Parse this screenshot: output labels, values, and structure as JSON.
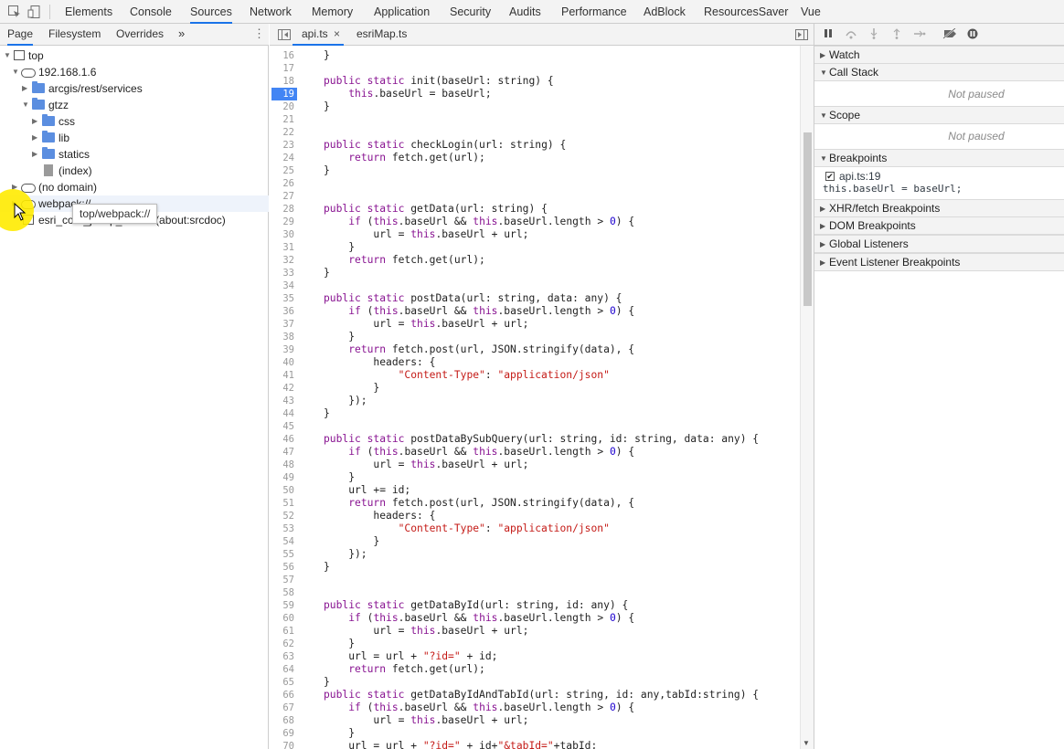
{
  "top_tabs": [
    "Elements",
    "Console",
    "Sources",
    "Network",
    "Memory",
    "Application",
    "Security",
    "Audits",
    "Performance",
    "AdBlock",
    "ResourcesSaver",
    "Vue"
  ],
  "active_top_tab": "Sources",
  "navigator": {
    "tabs": [
      "Page",
      "Filesystem",
      "Overrides"
    ],
    "more": "»",
    "tree": [
      "top",
      "192.168.1.6",
      "arcgis/rest/services",
      "gtzz",
      "css",
      "lib",
      "statics",
      "(index)",
      "(no domain)",
      "webpack://",
      "esri_core_jsonp_iframe (about:srcdoc)"
    ],
    "tooltip": "top/webpack://"
  },
  "editor": {
    "tabs": [
      "api.ts",
      "esriMap.ts"
    ],
    "close": "×",
    "lines": [
      {
        "n": "16",
        "t": "    }"
      },
      {
        "n": "17",
        "t": ""
      },
      {
        "n": "18",
        "t": "    public static init(baseUrl: string) {"
      },
      {
        "n": "19",
        "t": "        this.baseUrl = baseUrl;"
      },
      {
        "n": "20",
        "t": "    }"
      },
      {
        "n": "21",
        "t": ""
      },
      {
        "n": "22",
        "t": ""
      },
      {
        "n": "23",
        "t": "    public static checkLogin(url: string) {"
      },
      {
        "n": "24",
        "t": "        return fetch.get(url);"
      },
      {
        "n": "25",
        "t": "    }"
      },
      {
        "n": "26",
        "t": ""
      },
      {
        "n": "27",
        "t": ""
      },
      {
        "n": "28",
        "t": "    public static getData(url: string) {"
      },
      {
        "n": "29",
        "t": "        if (this.baseUrl && this.baseUrl.length > 0) {"
      },
      {
        "n": "30",
        "t": "            url = this.baseUrl + url;"
      },
      {
        "n": "31",
        "t": "        }"
      },
      {
        "n": "32",
        "t": "        return fetch.get(url);"
      },
      {
        "n": "33",
        "t": "    }"
      },
      {
        "n": "34",
        "t": ""
      },
      {
        "n": "35",
        "t": "    public static postData(url: string, data: any) {"
      },
      {
        "n": "36",
        "t": "        if (this.baseUrl && this.baseUrl.length > 0) {"
      },
      {
        "n": "37",
        "t": "            url = this.baseUrl + url;"
      },
      {
        "n": "38",
        "t": "        }"
      },
      {
        "n": "39",
        "t": "        return fetch.post(url, JSON.stringify(data), {"
      },
      {
        "n": "40",
        "t": "            headers: {"
      },
      {
        "n": "41",
        "t": "                \"Content-Type\": \"application/json\""
      },
      {
        "n": "42",
        "t": "            }"
      },
      {
        "n": "43",
        "t": "        });"
      },
      {
        "n": "44",
        "t": "    }"
      },
      {
        "n": "45",
        "t": ""
      },
      {
        "n": "46",
        "t": "    public static postDataBySubQuery(url: string, id: string, data: any) {"
      },
      {
        "n": "47",
        "t": "        if (this.baseUrl && this.baseUrl.length > 0) {"
      },
      {
        "n": "48",
        "t": "            url = this.baseUrl + url;"
      },
      {
        "n": "49",
        "t": "        }"
      },
      {
        "n": "50",
        "t": "        url += id;"
      },
      {
        "n": "51",
        "t": "        return fetch.post(url, JSON.stringify(data), {"
      },
      {
        "n": "52",
        "t": "            headers: {"
      },
      {
        "n": "53",
        "t": "                \"Content-Type\": \"application/json\""
      },
      {
        "n": "54",
        "t": "            }"
      },
      {
        "n": "55",
        "t": "        });"
      },
      {
        "n": "56",
        "t": "    }"
      },
      {
        "n": "57",
        "t": ""
      },
      {
        "n": "58",
        "t": ""
      },
      {
        "n": "59",
        "t": "    public static getDataById(url: string, id: any) {"
      },
      {
        "n": "60",
        "t": "        if (this.baseUrl && this.baseUrl.length > 0) {"
      },
      {
        "n": "61",
        "t": "            url = this.baseUrl + url;"
      },
      {
        "n": "62",
        "t": "        }"
      },
      {
        "n": "63",
        "t": "        url = url + \"?id=\" + id;"
      },
      {
        "n": "64",
        "t": "        return fetch.get(url);"
      },
      {
        "n": "65",
        "t": "    }"
      },
      {
        "n": "66",
        "t": "    public static getDataByIdAndTabId(url: string, id: any,tabId:string) {"
      },
      {
        "n": "67",
        "t": "        if (this.baseUrl && this.baseUrl.length > 0) {"
      },
      {
        "n": "68",
        "t": "            url = this.baseUrl + url;"
      },
      {
        "n": "69",
        "t": "        }"
      },
      {
        "n": "70",
        "t": "        url = url + \"?id=\" + id+\"&tabId=\"+tabId;"
      }
    ],
    "breakpoint_line": "19"
  },
  "debugger": {
    "sections": [
      "Watch",
      "Call Stack",
      "Scope",
      "Breakpoints",
      "XHR/fetch Breakpoints",
      "DOM Breakpoints",
      "Global Listeners",
      "Event Listener Breakpoints"
    ],
    "not_paused": "Not paused",
    "breakpoint": {
      "file": "api.ts:19",
      "code": "this.baseUrl = baseUrl;"
    }
  }
}
